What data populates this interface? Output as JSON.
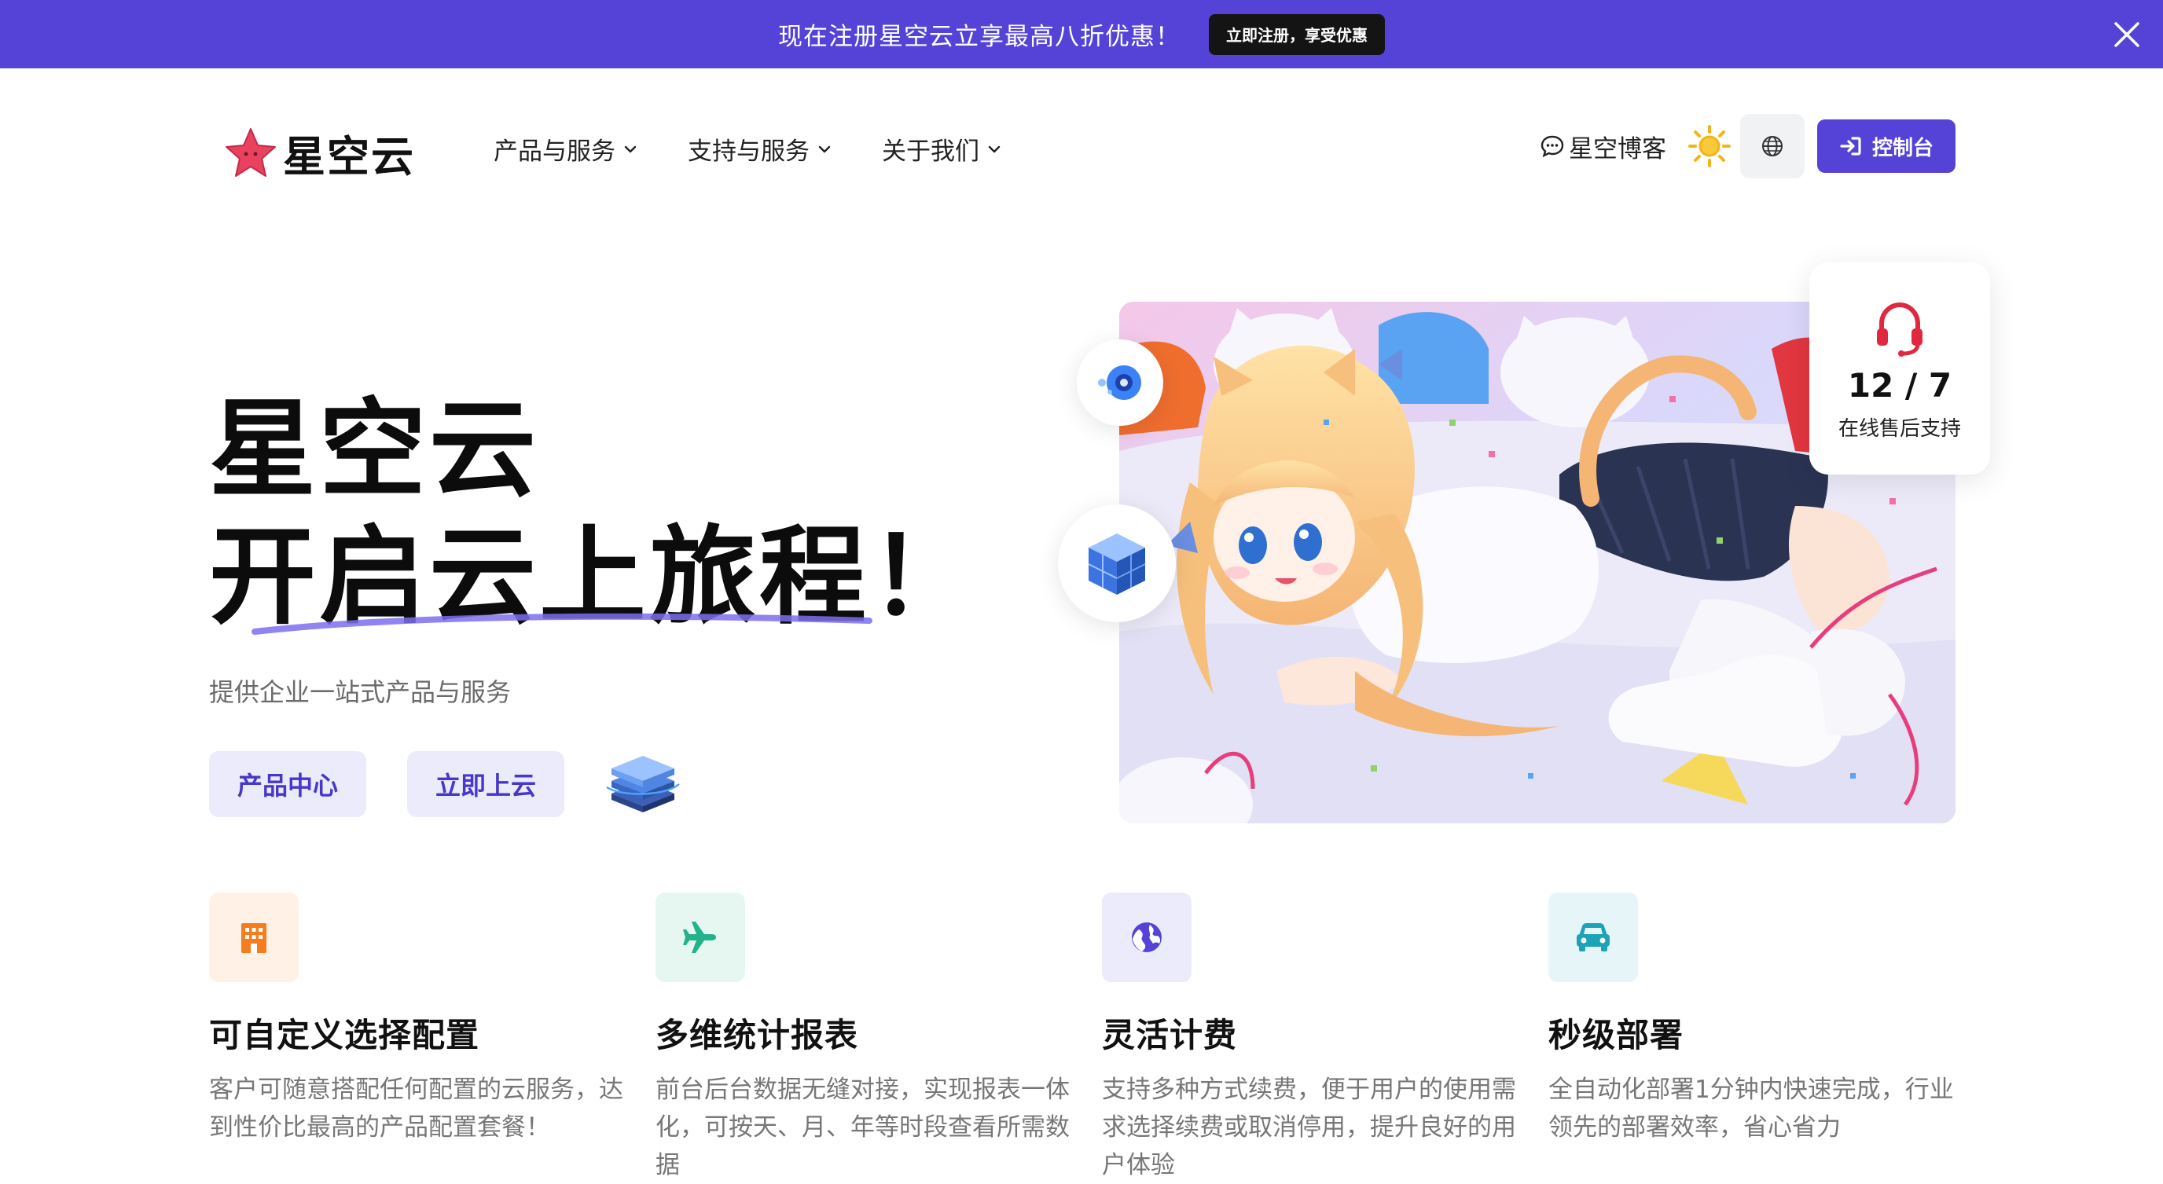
{
  "promo": {
    "text": "现在注册星空云立享最高八折优惠！",
    "button": "立即注册，享受优惠"
  },
  "nav": {
    "brand": "星空云",
    "menu": [
      {
        "label": "产品与服务"
      },
      {
        "label": "支持与服务"
      },
      {
        "label": "关于我们"
      }
    ],
    "blog": "星空博客",
    "console": "控制台"
  },
  "hero": {
    "title_line1": "星空云",
    "title_line2": "开启云上旅程！",
    "subtitle": "提供企业一站式产品与服务",
    "btn_products": "产品中心",
    "btn_start": "立即上云"
  },
  "support": {
    "value": "12 / 7",
    "label": "在线售后支持"
  },
  "features": [
    {
      "title": "可自定义选择配置",
      "desc": "客户可随意搭配任何配置的云服务，达到性价比最高的产品配置套餐！",
      "icon": "building-icon",
      "color": "#f57c1f"
    },
    {
      "title": "多维统计报表",
      "desc": "前台后台数据无缝对接，实现报表一体化，可按天、月、年等时段查看所需数据",
      "icon": "airplane-icon",
      "color": "#22b38a"
    },
    {
      "title": "灵活计费",
      "desc": "支持多种方式续费，便于用户的使用需求选择续费或取消停用，提升良好的用户体验",
      "icon": "globe-icon",
      "color": "#5443d6"
    },
    {
      "title": "秒级部署",
      "desc": "全自动化部署1分钟内快速完成，行业领先的部署效率，省心省力",
      "icon": "car-icon",
      "color": "#1ba3b8"
    }
  ],
  "colors": {
    "accent": "#5443d6",
    "accent_light": "#ecebfb"
  }
}
